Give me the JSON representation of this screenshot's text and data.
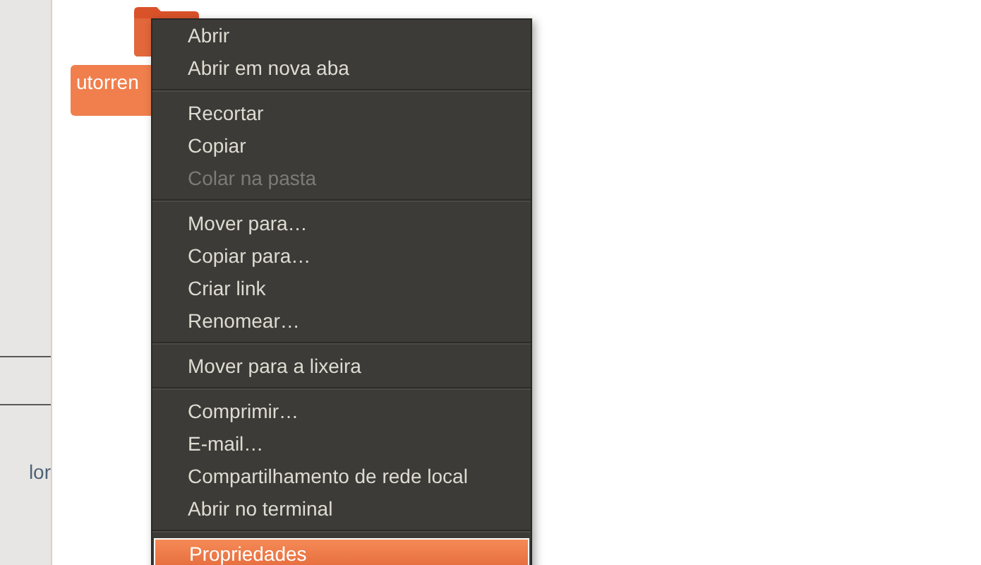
{
  "sidebar": {
    "items": [
      {
        "label": "lor"
      }
    ]
  },
  "folder": {
    "label": "utorren",
    "selected": true
  },
  "context_menu": {
    "items": [
      {
        "kind": "item",
        "label": "Abrir",
        "disabled": false,
        "selected": false
      },
      {
        "kind": "item",
        "label": "Abrir em nova aba",
        "disabled": false,
        "selected": false
      },
      {
        "kind": "separator"
      },
      {
        "kind": "item",
        "label": "Recortar",
        "disabled": false,
        "selected": false
      },
      {
        "kind": "item",
        "label": "Copiar",
        "disabled": false,
        "selected": false
      },
      {
        "kind": "item",
        "label": "Colar na pasta",
        "disabled": true,
        "selected": false
      },
      {
        "kind": "separator"
      },
      {
        "kind": "item",
        "label": "Mover para…",
        "disabled": false,
        "selected": false
      },
      {
        "kind": "item",
        "label": "Copiar para…",
        "disabled": false,
        "selected": false
      },
      {
        "kind": "item",
        "label": "Criar link",
        "disabled": false,
        "selected": false
      },
      {
        "kind": "item",
        "label": "Renomear…",
        "disabled": false,
        "selected": false
      },
      {
        "kind": "separator"
      },
      {
        "kind": "item",
        "label": "Mover para a lixeira",
        "disabled": false,
        "selected": false
      },
      {
        "kind": "separator"
      },
      {
        "kind": "item",
        "label": "Comprimir…",
        "disabled": false,
        "selected": false
      },
      {
        "kind": "item",
        "label": "E-mail…",
        "disabled": false,
        "selected": false
      },
      {
        "kind": "item",
        "label": "Compartilhamento de rede local",
        "disabled": false,
        "selected": false
      },
      {
        "kind": "item",
        "label": "Abrir no terminal",
        "disabled": false,
        "selected": false
      },
      {
        "kind": "separator"
      },
      {
        "kind": "item",
        "label": "Propriedades",
        "disabled": false,
        "selected": true
      }
    ]
  }
}
